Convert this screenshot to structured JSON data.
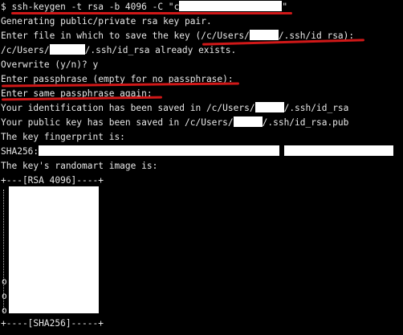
{
  "terminal": {
    "cmd_prompt": "$ ",
    "cmd_text": "ssh-keygen -t rsa -b 4096 -C \"",
    "cmd_partial": "c",
    "cmd_close": "\"",
    "l_generating": "Generating public/private rsa key pair.",
    "l_enter_file": "Enter file in which to save the key (/c/Users/",
    "l_enter_file_tail": "/.ssh/id_rsa):",
    "l_exists_pre": "/c/Users/",
    "l_exists_post": "/.ssh/id_rsa already exists.",
    "l_overwrite": "Overwrite (y/n)? y",
    "l_passphrase": "Enter passphrase (empty for no passphrase):",
    "l_same": "Enter same passphrase again:",
    "l_ident_pre": "Your identification has been saved in /c/Users/",
    "l_ident_post": "/.ssh/id_rsa",
    "l_pub_pre": "Your public key has been saved in /c/Users/",
    "l_pub_post": "/.ssh/id_rsa.pub",
    "l_fingerprint": "The key fingerprint is:",
    "l_sha": "SHA256:",
    "l_randomart": "The key's randomart image is:",
    "art_top": "+---[RSA 4096]----+",
    "art_bottom": "+----[SHA256]-----+",
    "art_left_chars": "o",
    "art_left_chars2": "o",
    "art_left_chars3": "o"
  },
  "colors": {
    "background": "#000000",
    "text": "#e8e8e8",
    "redaction": "#ffffff",
    "annotation": "#d01818"
  }
}
